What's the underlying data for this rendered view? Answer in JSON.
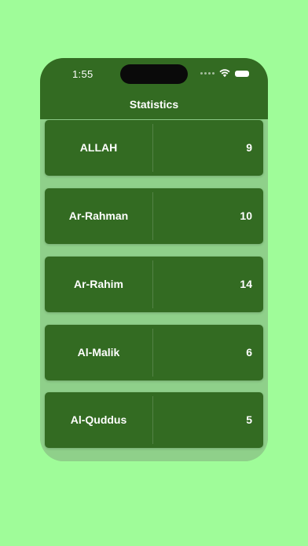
{
  "status_bar": {
    "time": "1:55",
    "icons": [
      "signal-dots-icon",
      "wifi-icon",
      "battery-icon"
    ]
  },
  "nav": {
    "title": "Statistics"
  },
  "colors": {
    "background": "#9ffc99",
    "header": "#336b22",
    "row": "#336b22",
    "list_background": "#8fd08a",
    "text": "#ffffff"
  },
  "rows": [
    {
      "name": "ALLAH",
      "count": "9"
    },
    {
      "name": "Ar-Rahman",
      "count": "10"
    },
    {
      "name": "Ar-Rahim",
      "count": "14"
    },
    {
      "name": "Al-Malik",
      "count": "6"
    },
    {
      "name": "Al-Quddus",
      "count": "5"
    }
  ]
}
